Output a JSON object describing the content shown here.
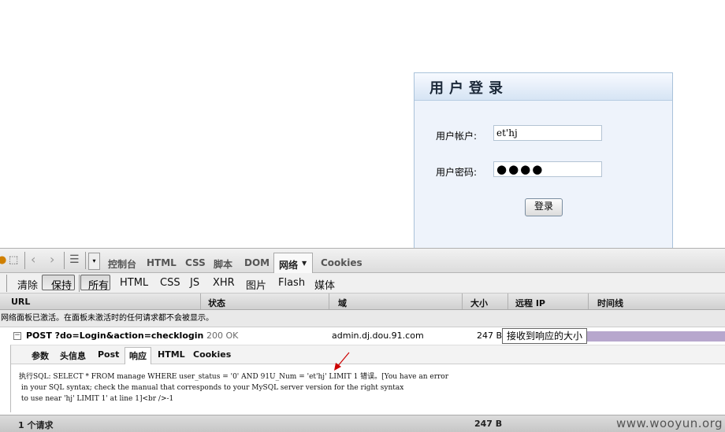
{
  "login": {
    "title": "用户登录",
    "account_label": "用户帐户:",
    "account_value": "et'hj",
    "password_label": "用户密码:",
    "password_mask": "●●●●",
    "submit_label": "登录"
  },
  "firebug": {
    "toolbar": {
      "tabs": [
        "控制台",
        "HTML",
        "CSS",
        "脚本",
        "DOM",
        "网络",
        "Cookies"
      ],
      "active_tab": "网络"
    },
    "net_toolbar": {
      "clear": "清除",
      "persist": "保持",
      "filters": [
        "所有",
        "HTML",
        "CSS",
        "JS",
        "XHR",
        "图片",
        "Flash",
        "媒体"
      ]
    },
    "columns": [
      "URL",
      "状态",
      "域",
      "大小",
      "远程 IP",
      "时间线"
    ],
    "notice": "网络面板已激活。在面板未激活时的任何请求都不会被显示。",
    "request": {
      "url": "POST ?do=Login&action=checklogin",
      "status": "200 OK",
      "domain": "admin.dj.dou.91.com",
      "size": "247 B",
      "tooltip": "接收到响应的大小"
    },
    "detail_tabs": [
      "参数",
      "头信息",
      "Post",
      "响应",
      "HTML",
      "Cookies"
    ],
    "active_detail_tab": "响应",
    "response_lines": [
      "执行SQL: SELECT * FROM manage WHERE user_status = '0' AND 91U_Num = 'et'hj' LIMIT 1 错误。[You have an error",
      " in your SQL syntax; check the manual that corresponds to your MySQL server version for the right syntax",
      " to use near 'hj' LIMIT 1' at line 1]<br />-1"
    ],
    "status_bar": {
      "count": "1 个请求",
      "total": "247 B"
    }
  },
  "watermark": "www.wooyun.org",
  "colors": {
    "timeline": "#b7a7cd",
    "arrow": "#cc0000"
  }
}
